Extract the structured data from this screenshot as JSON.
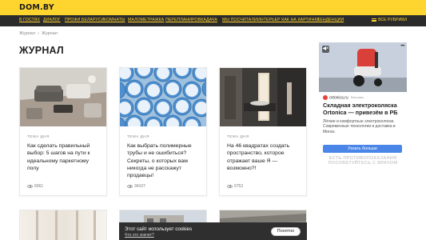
{
  "header": {
    "logo": "DOM.BY"
  },
  "nav": {
    "items": [
      "В ГОСТЯХ",
      "ДИАЛОГ",
      "ПРОФИ БЕЛАРУСИ",
      "КОМНАТЫ",
      "МАЛОМЕТРАЖКА",
      "ПЕРЕПЛАНИРОВКА",
      "ДАЧА",
      "МЫ ПОСЧИТАЛИ",
      "ИНТЕРЬЕР КАК НА КАРТИНКЕ",
      "ТЕНДЕНЦИИ"
    ],
    "all_rubrics": "ВСЕ РУБРИКИ"
  },
  "breadcrumb": {
    "home": "Журнал",
    "separator": "›",
    "current": "Журнал"
  },
  "page_title": "ЖУРНАЛ",
  "cards": [
    {
      "tag": "ТЕМА ДНЯ",
      "title": "Как сделать правильный выбор: 5 шагов на пути к идеальному паркетному полу",
      "views": "6561"
    },
    {
      "tag": "ТЕМА ДНЯ",
      "title": "Как выбрать полимерные трубы и не ошибиться? Секреты, о которых вам никогда не расскажут продавцы!",
      "views": "34107"
    },
    {
      "tag": "ТЕМА ДНЯ",
      "title": "На 46 квадратах создать пространство, которое отражает ваше Я — возможно?!",
      "views": "6752"
    }
  ],
  "ad": {
    "brand": "ortonica.ru",
    "ad_label": "Реклама",
    "title": "Складная электроколяска Ortonica — привезём в РБ",
    "text": "Лёгкие и комфортные электроколяски. Современные технологии и доставка в Минск.",
    "button": "Узнать больше",
    "disclaimer": "ЕСТЬ ПРОТИВОПОКАЗАНИЯ ПОСОВЕТУЙТЕСЬ С ВРАЧОМ"
  },
  "cookie": {
    "text": "Этот сайт использует cookies",
    "link": "Что это значит?",
    "button": "Понятно"
  },
  "colors": {
    "accent": "#fed42f",
    "nav_bg": "#2b2b2b",
    "ad_button": "#4a86e8"
  }
}
